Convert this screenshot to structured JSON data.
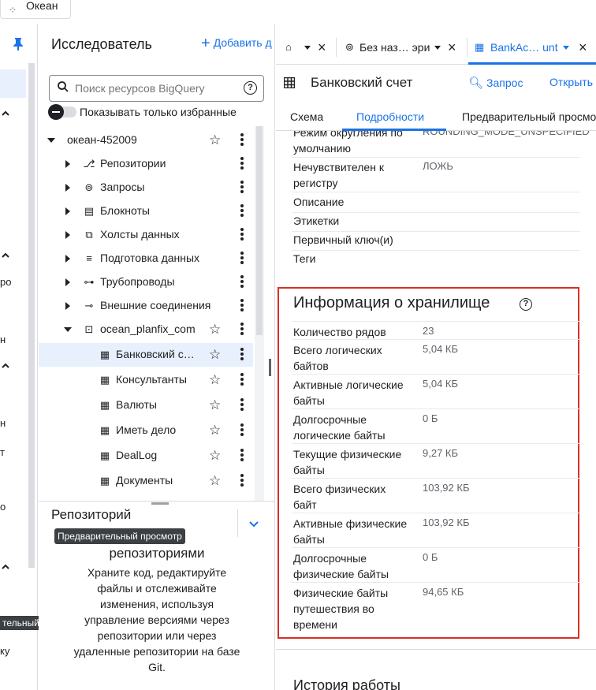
{
  "topbar": {
    "project_chip": "Океан"
  },
  "rail": {
    "cut_labels": [
      "ро",
      "н",
      "н",
      "т",
      "о"
    ],
    "badge": "тельный",
    "bottom": "ку"
  },
  "explorer": {
    "title": "Исследователь",
    "add_label": "Добавить д",
    "search_placeholder": "Поиск ресурсов BigQuery",
    "help_glyph": "?",
    "favorites_label": "Показывать только избранные",
    "project": "океан-452009",
    "items": [
      {
        "label": "Репозитории",
        "icon": "repo-icon"
      },
      {
        "label": "Запросы",
        "icon": "query-icon"
      },
      {
        "label": "Блокноты",
        "icon": "notebook-icon"
      },
      {
        "label": "Холсты данных",
        "icon": "canvas-icon"
      },
      {
        "label": "Подготовка данных",
        "icon": "data-prep-icon"
      },
      {
        "label": "Трубопроводы",
        "icon": "pipeline-icon"
      },
      {
        "label": "Внешние соединения",
        "icon": "connection-icon"
      },
      {
        "label": "ocean_planfix_com",
        "icon": "dataset-icon"
      }
    ],
    "tables": [
      "Банковский с…",
      "Консультанты",
      "Валюты",
      "Иметь дело",
      "DealLog",
      "Документы"
    ]
  },
  "repo_panel": {
    "title": "Репозиторий",
    "badge": "Предварительный просмотр",
    "subtitle": "репозиториями",
    "description": "Храните код, редактируйте файлы и отслеживайте изменения, используя управление версиями через репозитории или через удаленные репозитории на базе Git."
  },
  "tabs": [
    {
      "label": "",
      "icon": "home-icon"
    },
    {
      "label": "Без наз… эри",
      "icon": "query-tab-icon"
    },
    {
      "label": "BankAc… unt",
      "icon": "table-tab-icon"
    }
  ],
  "detail": {
    "title": "Банковский счет",
    "query_label": "Запрос",
    "open_label": "Открыть"
  },
  "subtabs": [
    "Схема",
    "Подробности",
    "Предварительный просмотр"
  ],
  "info_rows": [
    {
      "key": "Режим округления по умолчанию",
      "value": "ROUNDING_MODE_UNSPECIFIED"
    },
    {
      "key": "Нечувствителен к регистру",
      "value": "ЛОЖЬ"
    },
    {
      "key": "Описание",
      "value": ""
    },
    {
      "key": "Этикетки",
      "value": ""
    },
    {
      "key": "Первичный ключ(и)",
      "value": ""
    },
    {
      "key": "Теги",
      "value": ""
    }
  ],
  "storage": {
    "title": "Информация о хранилище",
    "rows": [
      {
        "key": "Количество рядов",
        "value": "23"
      },
      {
        "key": "Всего логических байтов",
        "value": "5,04 КБ"
      },
      {
        "key": "Активные логические байты",
        "value": "5,04 КБ"
      },
      {
        "key": "Долгосрочные логические байты",
        "value": "0 Б"
      },
      {
        "key": "Текущие физические байты",
        "value": "9,27 КБ"
      },
      {
        "key": "Всего физических байт",
        "value": "103,92 КБ"
      },
      {
        "key": "Активные физические байты",
        "value": "103,92 КБ"
      },
      {
        "key": "Долгосрочные физические байты",
        "value": "0 Б"
      },
      {
        "key": "Физические байты путешествия во времени",
        "value": "94,65 КБ"
      }
    ]
  },
  "history_title": "История работы",
  "colors": {
    "accent": "#1a73e8",
    "highlight_border": "#d93025",
    "selected_bg": "#e8f0fe"
  }
}
